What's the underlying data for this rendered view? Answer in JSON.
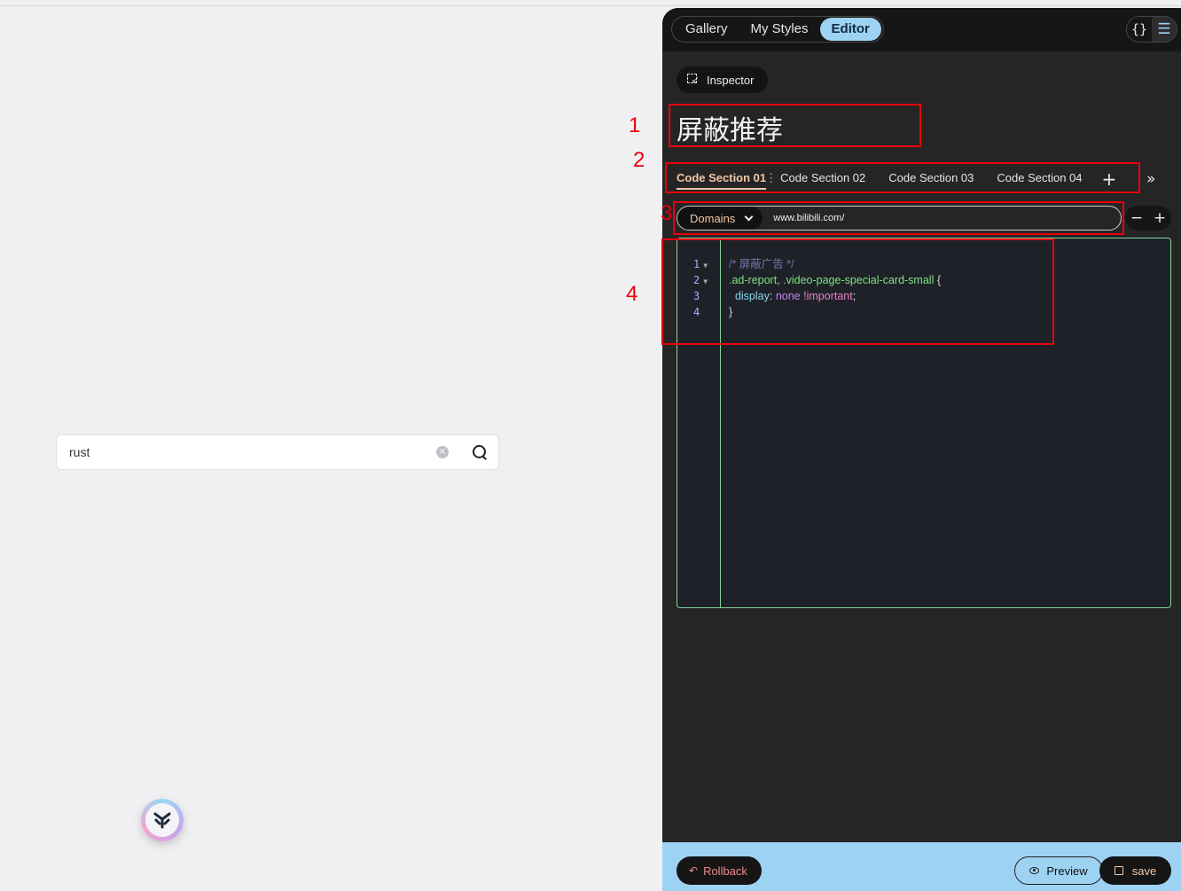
{
  "search": {
    "value": "rust"
  },
  "panel": {
    "nav": [
      {
        "label": "Gallery",
        "active": false
      },
      {
        "label": "My Styles",
        "active": false
      },
      {
        "label": "Editor",
        "active": true
      }
    ],
    "header_icons": {
      "code": "{}",
      "menu": "☰"
    },
    "inspector_label": "Inspector",
    "style_title": "屏蔽推荐",
    "sections": [
      {
        "label": "Code Section 01",
        "active": true
      },
      {
        "label": "Code Section 02",
        "active": false
      },
      {
        "label": "Code Section 03",
        "active": false
      },
      {
        "label": "Code Section 04",
        "active": false
      }
    ],
    "section_add": "+",
    "section_more": "»",
    "domain_type": "Domains",
    "domain_value": "www.bilibili.com/",
    "domain_minus": "−",
    "domain_plus": "+",
    "code_lines": [
      {
        "n": "1",
        "fold": true
      },
      {
        "n": "2",
        "fold": true
      },
      {
        "n": "3",
        "fold": false
      },
      {
        "n": "4",
        "fold": false
      }
    ],
    "code": {
      "comment": "/* 屏蔽广告 */",
      "selector": ".ad-report, .video-page-special-card-small",
      "open_brace": " {",
      "property": "display",
      "value": "none",
      "important": "!important",
      "close_brace": "}"
    },
    "footer": {
      "rollback": "Rollback",
      "preview": "Preview",
      "save": "save"
    }
  },
  "annotations": [
    "1",
    "2",
    "3",
    "4"
  ],
  "colors": {
    "accent": "#9ed2f3",
    "annotation": "#e8000b",
    "editor_border": "#86d49a"
  }
}
